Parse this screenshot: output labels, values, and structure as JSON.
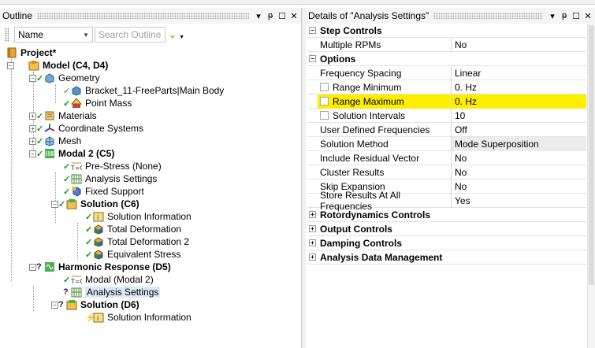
{
  "outline": {
    "title": "Outline",
    "filter": {
      "selected": "Name",
      "search_placeholder": "Search Outline"
    },
    "tree": [
      {
        "label": "Project*",
        "bold": true
      },
      {
        "label": "Model (C4, D4)",
        "bold": true
      },
      {
        "label": "Geometry"
      },
      {
        "label": "Bracket_11-FreeParts|Main Body"
      },
      {
        "label": "Point Mass"
      },
      {
        "label": "Materials"
      },
      {
        "label": "Coordinate Systems"
      },
      {
        "label": "Mesh"
      },
      {
        "label": "Modal 2 (C5)",
        "bold": true
      },
      {
        "label": "Pre-Stress (None)"
      },
      {
        "label": "Analysis Settings"
      },
      {
        "label": "Fixed Support"
      },
      {
        "label": "Solution (C6)",
        "bold": true
      },
      {
        "label": "Solution Information"
      },
      {
        "label": "Total Deformation"
      },
      {
        "label": "Total Deformation 2"
      },
      {
        "label": "Equivalent Stress"
      },
      {
        "label": "Harmonic Response (D5)",
        "bold": true
      },
      {
        "label": "Modal (Modal 2)"
      },
      {
        "label": "Analysis Settings"
      },
      {
        "label": "Solution (D6)",
        "bold": true
      },
      {
        "label": "Solution Information"
      }
    ]
  },
  "details": {
    "title": "Details of \"Analysis Settings\"",
    "rows": [
      {
        "type": "cat",
        "label": "Step Controls",
        "sign": "−"
      },
      {
        "type": "prop",
        "name": "Multiple RPMs",
        "value": "No"
      },
      {
        "type": "cat",
        "label": "Options",
        "sign": "−"
      },
      {
        "type": "prop",
        "name": "Frequency Spacing",
        "value": "Linear"
      },
      {
        "type": "prop",
        "name": "Range Minimum",
        "value": "0. Hz",
        "checkbox": true
      },
      {
        "type": "prop",
        "name": "Range Maximum",
        "value": "0. Hz",
        "checkbox": true,
        "highlight": true
      },
      {
        "type": "prop",
        "name": "Solution Intervals",
        "value": "10",
        "checkbox": true
      },
      {
        "type": "prop",
        "name": "User Defined Frequencies",
        "value": "Off"
      },
      {
        "type": "prop",
        "name": "Solution Method",
        "value": "Mode Superposition",
        "gray": true
      },
      {
        "type": "prop",
        "name": "Include Residual Vector",
        "value": "No"
      },
      {
        "type": "prop",
        "name": "Cluster Results",
        "value": "No"
      },
      {
        "type": "prop",
        "name": "Skip Expansion",
        "value": "No"
      },
      {
        "type": "prop",
        "name": "Store Results At All Frequencies",
        "value": "Yes"
      },
      {
        "type": "cat",
        "label": "Rotordynamics Controls",
        "sign": "+"
      },
      {
        "type": "cat",
        "label": "Output Controls",
        "sign": "+"
      },
      {
        "type": "cat",
        "label": "Damping Controls",
        "sign": "+"
      },
      {
        "type": "cat",
        "label": "Analysis Data Management",
        "sign": "+"
      }
    ]
  },
  "colors": {
    "highlight": "#ffee00",
    "check": "#1a9a1a",
    "folder": "#e8a23a"
  }
}
